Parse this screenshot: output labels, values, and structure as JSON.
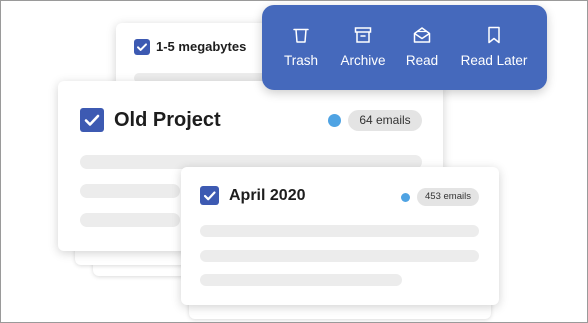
{
  "toolbar": {
    "items": [
      {
        "label": "Trash",
        "icon": "trash-icon"
      },
      {
        "label": "Archive",
        "icon": "archive-icon"
      },
      {
        "label": "Read",
        "icon": "open-envelope-icon"
      },
      {
        "label": "Read Later",
        "icon": "bookmark-icon"
      }
    ],
    "background": "#4569bc"
  },
  "cards": {
    "back": {
      "title": "1-5 megabytes"
    },
    "middle": {
      "title": "Old Project",
      "count": "64 emails"
    },
    "front": {
      "title": "April 2020",
      "count": "453 emails"
    }
  },
  "colors": {
    "accent": "#3d5ab2",
    "dot": "#4fa3e3",
    "placeholder": "#ececec"
  }
}
